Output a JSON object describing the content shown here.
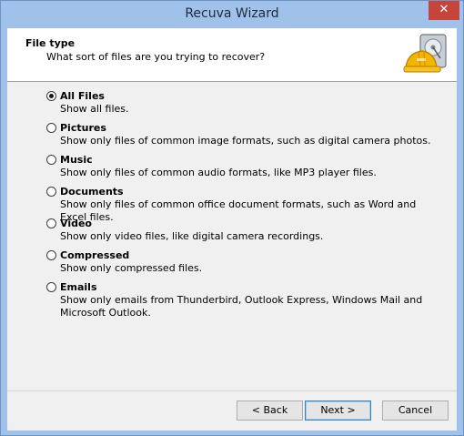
{
  "window": {
    "title": "Recuva Wizard",
    "close_glyph": "✕"
  },
  "header": {
    "title": "File type",
    "subtitle": "What sort of files are you trying to recover?",
    "logo_icon": "hard-drive-with-hardhat-icon"
  },
  "options": [
    {
      "label": "All Files",
      "description": "Show all files.",
      "checked": true
    },
    {
      "label": "Pictures",
      "description": "Show only files of common image formats, such as digital camera photos.",
      "checked": false
    },
    {
      "label": "Music",
      "description": "Show only files of common audio formats, like MP3 player files.",
      "checked": false
    },
    {
      "label": "Documents",
      "description": "Show only files of common office document formats, such as Word and Excel files.",
      "checked": false
    },
    {
      "label": "Video",
      "description": "Show only video files, like digital camera recordings.",
      "checked": false
    },
    {
      "label": "Compressed",
      "description": "Show only compressed files.",
      "checked": false
    },
    {
      "label": "Emails",
      "description": "Show only emails from Thunderbird, Outlook Express, Windows Mail and Microsoft Outlook.",
      "checked": false
    }
  ],
  "buttons": {
    "back": "< Back",
    "next": "Next >",
    "cancel": "Cancel"
  }
}
